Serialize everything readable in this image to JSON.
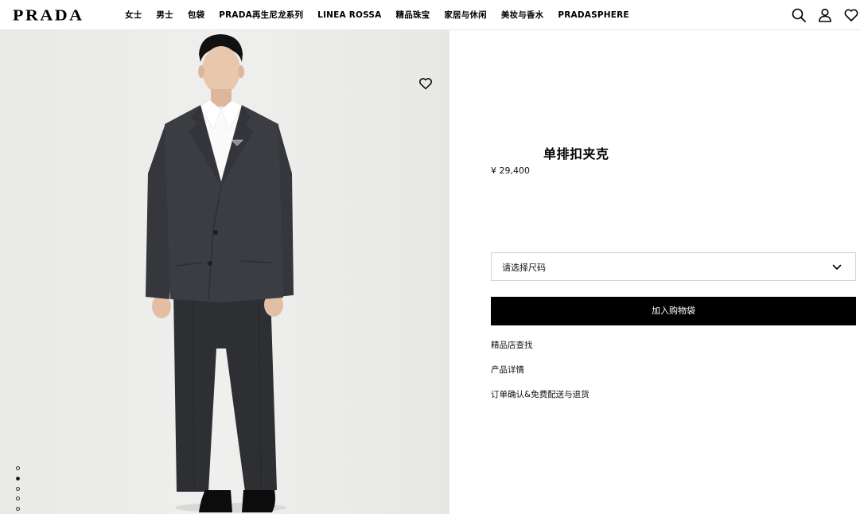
{
  "header": {
    "logo": "PRADA",
    "nav": [
      "女士",
      "男士",
      "包袋",
      "PRADA再生尼龙系列",
      "LINEA ROSSA",
      "精品珠宝",
      "家居与休闲",
      "美妆与香水",
      "PRADASPHERE"
    ],
    "icons": [
      "search-icon",
      "account-icon",
      "wishlist-icon"
    ]
  },
  "gallery": {
    "images_count": 6,
    "active_index": 1,
    "background": "#ececea"
  },
  "product": {
    "title": "单排扣夹克",
    "price": "¥ 29,400",
    "size_placeholder": "请选择尺码",
    "add_to_bag": "加入购物袋",
    "links": [
      "精品店查找",
      "产品详情",
      "订单确认&免费配送与退货"
    ]
  },
  "colors": {
    "primary": "#000000",
    "background": "#ffffff",
    "border": "#d6d6d6"
  }
}
